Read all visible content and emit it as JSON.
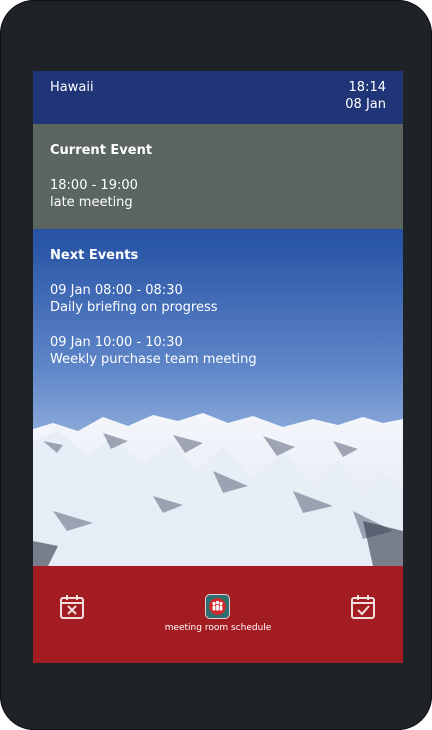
{
  "header": {
    "location": "Hawaii",
    "time": "18:14",
    "date": "08 Jan"
  },
  "current_event": {
    "heading": "Current Event",
    "time_range": "18:00 - 19:00",
    "title": "late meeting"
  },
  "next_events": {
    "heading": "Next Events",
    "items": [
      {
        "time_range": "09 Jan  08:00 - 08:30",
        "title": "Daily briefing on progress"
      },
      {
        "time_range": "09 Jan  10:00 - 10:30",
        "title": "Weekly purchase team meeting"
      }
    ]
  },
  "bottom_bar": {
    "left_icon": "calendar-x-icon",
    "center_icon": "people-group-icon",
    "center_label": "meeting room schedule",
    "right_icon": "calendar-check-icon",
    "color": "#a31c21"
  }
}
